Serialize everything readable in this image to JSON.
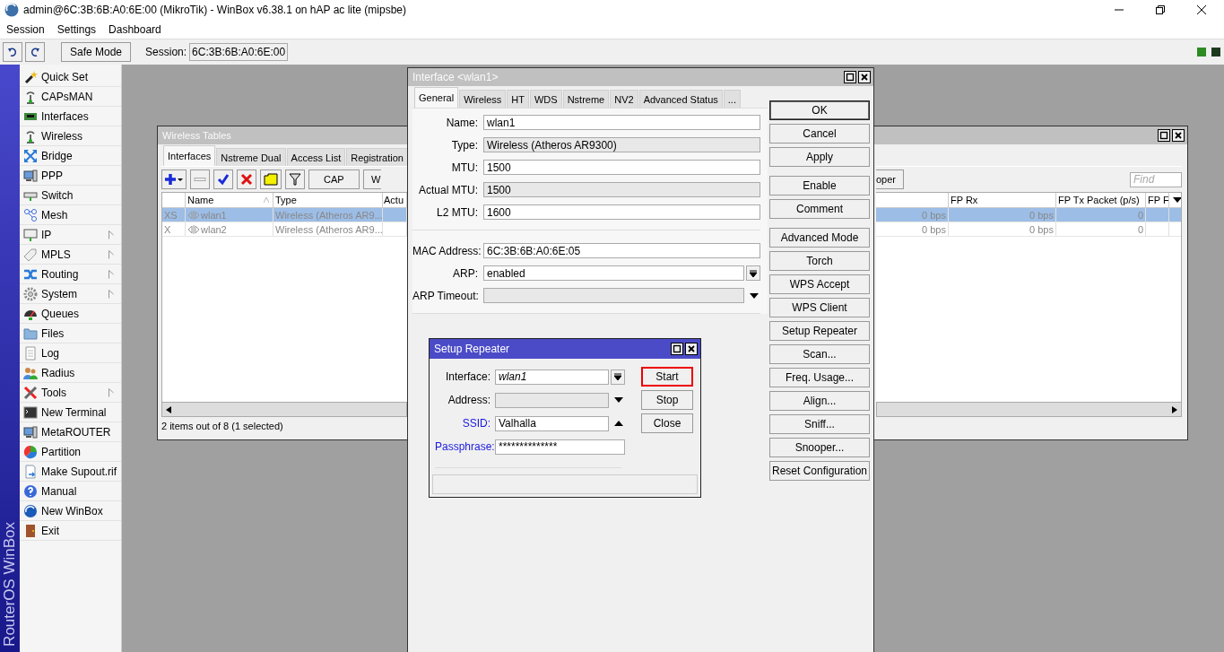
{
  "window": {
    "title": "admin@6C:3B:6B:A0:6E:00 (MikroTik) - WinBox v6.38.1 on hAP ac lite (mipsbe)"
  },
  "menu": [
    "Session",
    "Settings",
    "Dashboard"
  ],
  "toolbar": {
    "safe_mode": "Safe Mode",
    "session_label": "Session:",
    "session_value": "6C:3B:6B:A0:6E:00"
  },
  "brand": "RouterOS WinBox",
  "sidebar": {
    "items": [
      {
        "label": "Quick Set",
        "submenu": false
      },
      {
        "label": "CAPsMAN",
        "submenu": false
      },
      {
        "label": "Interfaces",
        "submenu": false
      },
      {
        "label": "Wireless",
        "submenu": false
      },
      {
        "label": "Bridge",
        "submenu": false
      },
      {
        "label": "PPP",
        "submenu": false
      },
      {
        "label": "Switch",
        "submenu": false
      },
      {
        "label": "Mesh",
        "submenu": false
      },
      {
        "label": "IP",
        "submenu": true
      },
      {
        "label": "MPLS",
        "submenu": true
      },
      {
        "label": "Routing",
        "submenu": true
      },
      {
        "label": "System",
        "submenu": true
      },
      {
        "label": "Queues",
        "submenu": false
      },
      {
        "label": "Files",
        "submenu": false
      },
      {
        "label": "Log",
        "submenu": false
      },
      {
        "label": "Radius",
        "submenu": false
      },
      {
        "label": "Tools",
        "submenu": true
      },
      {
        "label": "New Terminal",
        "submenu": false
      },
      {
        "label": "MetaROUTER",
        "submenu": false
      },
      {
        "label": "Partition",
        "submenu": false
      },
      {
        "label": "Make Supout.rif",
        "submenu": false
      },
      {
        "label": "Manual",
        "submenu": false
      },
      {
        "label": "New WinBox",
        "submenu": false
      },
      {
        "label": "Exit",
        "submenu": false
      }
    ]
  },
  "wireless_tables": {
    "title": "Wireless Tables",
    "tabs": [
      {
        "label": "Interfaces",
        "selected": true
      },
      {
        "label": "Nstreme Dual",
        "selected": false
      },
      {
        "label": "Access List",
        "selected": false
      },
      {
        "label": "Registration",
        "selected": false
      }
    ],
    "toolbar_buttons": [
      "CAP",
      "W"
    ],
    "toolbar_button_right": "oper",
    "find": {
      "placeholder": "Find"
    },
    "columns_left": [
      "Name",
      "Type",
      "Actu"
    ],
    "columns_right": [
      "FP Rx",
      "FP Tx Packet (p/s)",
      "FP F"
    ],
    "rows": [
      {
        "flags": "XS",
        "name": "wlan1",
        "type": "Wireless (Atheros AR9...",
        "column_cut": "0 bps",
        "fp_rx": "0 bps",
        "fp_tx_packet": "0",
        "selected": true,
        "disabled": true
      },
      {
        "flags": "X",
        "name": "wlan2",
        "type": "Wireless (Atheros AR9...",
        "column_cut": "0 bps",
        "fp_rx": "0 bps",
        "fp_tx_packet": "0",
        "selected": false,
        "disabled": true
      }
    ],
    "status": "2 items out of 8 (1 selected)"
  },
  "interface_window": {
    "title": "Interface <wlan1>",
    "tabs": [
      {
        "label": "General",
        "selected": true
      },
      {
        "label": "Wireless",
        "selected": false
      },
      {
        "label": "HT",
        "selected": false
      },
      {
        "label": "WDS",
        "selected": false
      },
      {
        "label": "Nstreme",
        "selected": false
      },
      {
        "label": "NV2",
        "selected": false
      },
      {
        "label": "Advanced Status",
        "selected": false
      },
      {
        "label": "...",
        "selected": false
      }
    ],
    "field_groups": [
      [
        {
          "label": "Name:",
          "value": "wlan1",
          "kind": "input"
        },
        {
          "label": "Type:",
          "value": "Wireless (Atheros AR9300)",
          "kind": "readonly"
        },
        {
          "label": "MTU:",
          "value": "1500",
          "kind": "input"
        },
        {
          "label": "Actual MTU:",
          "value": "1500",
          "kind": "readonly"
        },
        {
          "label": "L2 MTU:",
          "value": "1600",
          "kind": "input"
        }
      ],
      [
        {
          "label": "MAC Address:",
          "value": "6C:3B:6B:A0:6E:05",
          "kind": "input"
        },
        {
          "label": "ARP:",
          "value": "enabled",
          "kind": "select"
        },
        {
          "label": "ARP Timeout:",
          "kind": "dropdown"
        }
      ]
    ],
    "button_groups": [
      [
        {
          "label": "OK",
          "focused": true
        },
        {
          "label": "Cancel",
          "focused": false
        },
        {
          "label": "Apply",
          "focused": false
        }
      ],
      [
        {
          "label": "Enable",
          "focused": false
        },
        {
          "label": "Comment",
          "focused": false
        }
      ],
      [
        {
          "label": "Advanced Mode",
          "focused": false
        },
        {
          "label": "Torch",
          "focused": false
        },
        {
          "label": "WPS Accept",
          "focused": false
        },
        {
          "label": "WPS Client",
          "focused": false
        },
        {
          "label": "Setup Repeater",
          "focused": false
        },
        {
          "label": "Scan...",
          "focused": false
        },
        {
          "label": "Freq. Usage...",
          "focused": false
        },
        {
          "label": "Align...",
          "focused": false
        },
        {
          "label": "Sniff...",
          "focused": false
        },
        {
          "label": "Snooper...",
          "focused": false
        },
        {
          "label": "Reset Configuration",
          "focused": false
        }
      ]
    ]
  },
  "setup_repeater": {
    "title": "Setup Repeater",
    "fields": [
      {
        "label": "Interface:",
        "value": "wlan1",
        "kind": "select",
        "required": false,
        "italic": true
      },
      {
        "label": "Address:",
        "kind": "dropdown",
        "required": false
      },
      {
        "label": "SSID:",
        "value": "Valhalla",
        "kind": "collapse",
        "required": true,
        "italic": false
      },
      {
        "label": "Passphrase:",
        "value": "**************",
        "kind": "input",
        "required": true,
        "italic": false
      }
    ],
    "buttons": [
      {
        "label": "Start",
        "highlighted": true
      },
      {
        "label": "Stop",
        "highlighted": false
      },
      {
        "label": "Close",
        "highlighted": false
      }
    ]
  }
}
